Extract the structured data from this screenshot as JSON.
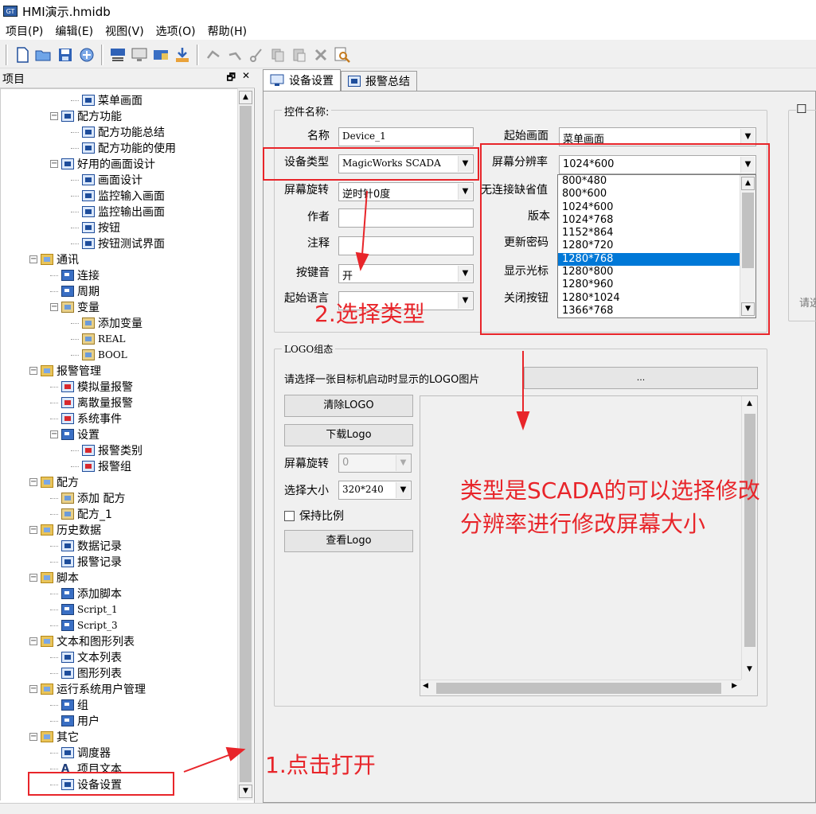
{
  "window": {
    "title": "HMI演示.hmidb"
  },
  "menu": [
    "项目(P)",
    "编辑(E)",
    "视图(V)",
    "选项(O)",
    "帮助(H)"
  ],
  "left_panel": {
    "title": "项目",
    "pin": "🗗",
    "close": "✕"
  },
  "tree": [
    {
      "label": "菜单画面",
      "icon": "screen-icon"
    },
    {
      "label": "配方功能",
      "icon": "screen-icon",
      "expander": "⊟"
    },
    {
      "label": "配方功能总结",
      "icon": "screen-icon"
    },
    {
      "label": "配方功能的使用",
      "icon": "screen-icon"
    },
    {
      "label": "好用的画面设计",
      "icon": "screen-icon",
      "expander": "⊟"
    },
    {
      "label": "画面设计",
      "icon": "screen-icon"
    },
    {
      "label": "监控输入画面",
      "icon": "screen-icon"
    },
    {
      "label": "监控输出画面",
      "icon": "screen-icon"
    },
    {
      "label": "按钮",
      "icon": "screen-icon"
    },
    {
      "label": "按钮测试界面",
      "icon": "screen-icon"
    },
    {
      "label": "通讯",
      "icon": "folder-icon",
      "expander": "⊟"
    },
    {
      "label": "连接",
      "icon": "connection-icon"
    },
    {
      "label": "周期",
      "icon": "cycle-icon"
    },
    {
      "label": "变量",
      "icon": "variable-icon",
      "expander": "⊟"
    },
    {
      "label": "添加变量",
      "icon": "variable-icon"
    },
    {
      "label": "REAL",
      "icon": "variable-icon"
    },
    {
      "label": "BOOL",
      "icon": "variable-icon"
    },
    {
      "label": "报警管理",
      "icon": "folder-icon",
      "expander": "⊟"
    },
    {
      "label": "模拟量报警",
      "icon": "alarm-icon"
    },
    {
      "label": "离散量报警",
      "icon": "alarm-icon"
    },
    {
      "label": "系统事件",
      "icon": "alarm-icon"
    },
    {
      "label": "设置",
      "icon": "settings-icon",
      "expander": "⊟"
    },
    {
      "label": "报警类别",
      "icon": "alarm-class-icon"
    },
    {
      "label": "报警组",
      "icon": "alarm-group-icon"
    },
    {
      "label": "配方",
      "icon": "folder-icon",
      "expander": "⊟"
    },
    {
      "label": "添加 配方",
      "icon": "recipe-icon"
    },
    {
      "label": "配方_1",
      "icon": "recipe-icon"
    },
    {
      "label": "历史数据",
      "icon": "folder-icon",
      "expander": "⊟"
    },
    {
      "label": "数据记录",
      "icon": "log-icon"
    },
    {
      "label": "报警记录",
      "icon": "log-icon"
    },
    {
      "label": "脚本",
      "icon": "folder-icon",
      "expander": "⊟"
    },
    {
      "label": "添加脚本",
      "icon": "script-icon"
    },
    {
      "label": "Script_1",
      "icon": "script-icon"
    },
    {
      "label": "Script_3",
      "icon": "script-icon"
    },
    {
      "label": "文本和图形列表",
      "icon": "folder-icon",
      "expander": "⊟"
    },
    {
      "label": "文本列表",
      "icon": "text-list-icon"
    },
    {
      "label": "图形列表",
      "icon": "graphic-list-icon"
    },
    {
      "label": "运行系统用户管理",
      "icon": "folder-icon",
      "expander": "⊟"
    },
    {
      "label": "组",
      "icon": "group-icon"
    },
    {
      "label": "用户",
      "icon": "user-icon"
    },
    {
      "label": "其它",
      "icon": "folder-icon",
      "expander": "⊟"
    },
    {
      "label": "调度器",
      "icon": "scheduler-icon"
    },
    {
      "label": "项目文本",
      "icon": "text-icon",
      "glyph": "A"
    },
    {
      "label": "设备设置",
      "icon": "device-settings-icon"
    }
  ],
  "tabs": [
    {
      "label": "设备设置",
      "active": true
    },
    {
      "label": "报警总结",
      "active": false
    }
  ],
  "control_group": {
    "title": "控件名称:",
    "name_label": "名称",
    "name_value": "Device_1",
    "device_type_label": "设备类型",
    "device_type_value": "MagicWorks SCADA",
    "rotation_label": "屏幕旋转",
    "rotation_value": "逆时针0度",
    "author_label": "作者",
    "author_value": "",
    "comment_label": "注释",
    "comment_value": "",
    "key_sound_label": "按键音",
    "key_sound_value": "开",
    "start_lang_label": "起始语言",
    "start_lang_value": "",
    "start_screen_label": "起始画面",
    "start_screen_value": "菜单画面",
    "resolution_label": "屏幕分辨率",
    "resolution_value": "1024*600",
    "no_conn_label": "无连接缺省值",
    "version_label": "版本",
    "update_pwd_label": "更新密码",
    "show_cursor_label": "显示光标",
    "close_button_label": "关闭按钮"
  },
  "resolution_options": [
    "800*480",
    "800*600",
    "1024*600",
    "1024*768",
    "1152*864",
    "1280*720",
    "1280*768",
    "1280*800",
    "1280*960",
    "1280*1024",
    "1366*768"
  ],
  "resolution_selected": "1280*768",
  "right_partial": {
    "checkbox_mark": "☐",
    "hint": "请选"
  },
  "logo_group": {
    "title": "LOGO组态",
    "prompt": "请选择一张目标机启动时显示的LOGO图片",
    "browse_label": "...",
    "clear_label": "清除LOGO",
    "download_label": "下载Logo",
    "rotation_label": "屏幕旋转",
    "rotation_value": "0",
    "size_label": "选择大小",
    "size_value": "320*240",
    "keep_ratio_label": "保持比例",
    "view_label": "查看Logo"
  },
  "annotations": {
    "step1": "1.点击打开",
    "step2": "2.选择类型",
    "note": "类型是SCADA的可以选择修改\n分辨率进行修改屏幕大小"
  },
  "colors": {
    "annotation": "#e8252a",
    "selection": "#0078d7"
  }
}
